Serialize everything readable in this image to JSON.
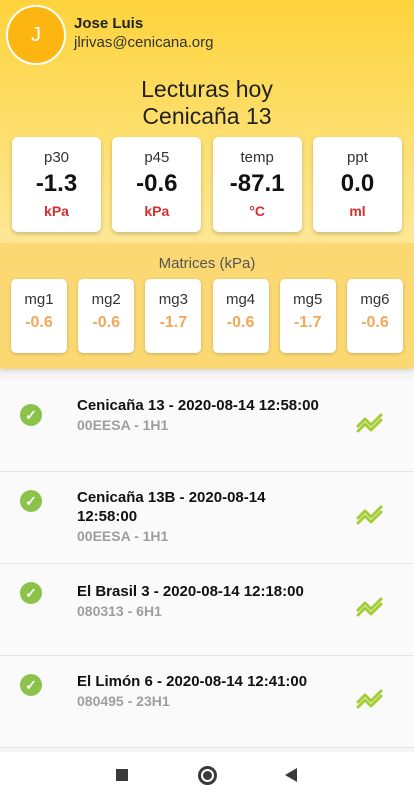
{
  "user": {
    "avatar_initial": "J",
    "name": "Jose Luis",
    "email": "jlrivas@cenicana.org"
  },
  "title": {
    "line1": "Lecturas hoy",
    "line2": "Cenicaña 13"
  },
  "readings": [
    {
      "label": "p30",
      "value": "-1.3",
      "unit": "kPa"
    },
    {
      "label": "p45",
      "value": "-0.6",
      "unit": "kPa"
    },
    {
      "label": "temp",
      "value": "-87.1",
      "unit": "°C"
    },
    {
      "label": "ppt",
      "value": "0.0",
      "unit": "ml"
    }
  ],
  "matrices": {
    "title": "Matrices (kPa)",
    "items": [
      {
        "label": "mg1",
        "value": "-0.6"
      },
      {
        "label": "mg2",
        "value": "-0.6"
      },
      {
        "label": "mg3",
        "value": "-1.7"
      },
      {
        "label": "mg4",
        "value": "-0.6"
      },
      {
        "label": "mg5",
        "value": "-1.7"
      },
      {
        "label": "mg6",
        "value": "-0.6"
      }
    ]
  },
  "stations": [
    {
      "title": "Cenicaña 13 - 2020-08-14 12:58:00",
      "subtitle": "00EESA - 1H1"
    },
    {
      "title": "Cenicaña 13B - 2020-08-14 12:58:00",
      "subtitle": "00EESA - 1H1"
    },
    {
      "title": "El Brasil 3 - 2020-08-14 12:18:00",
      "subtitle": "080313 - 6H1"
    },
    {
      "title": "El Limón 6 - 2020-08-14 12:41:00",
      "subtitle": "080495 - 23H1"
    }
  ],
  "colors": {
    "accent": "#fdd33c",
    "unit_red": "#d32f2f",
    "matrix_orange": "#f0a859",
    "check_green": "#8bc34a",
    "trend_green": "#a4cc33"
  },
  "icons": {
    "status": "check-circle-icon",
    "trend": "trending-icon"
  }
}
